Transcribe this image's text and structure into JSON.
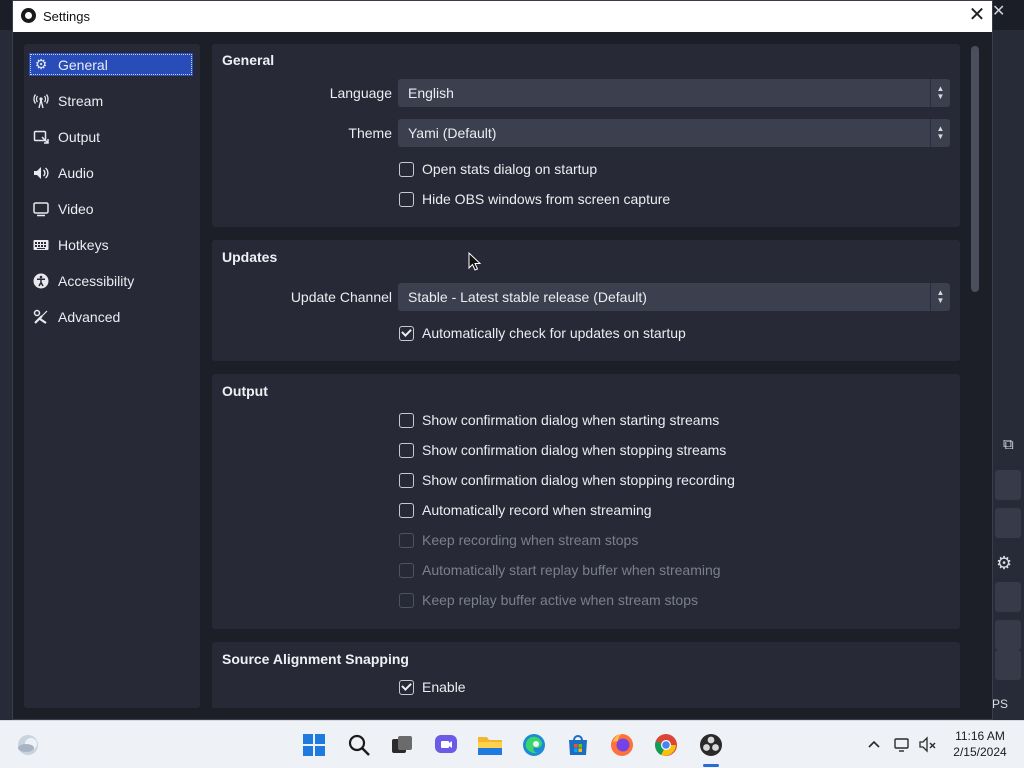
{
  "window": {
    "title": "Settings"
  },
  "sidebar": {
    "items": [
      {
        "label": "General",
        "icon": "gear-icon",
        "active": true
      },
      {
        "label": "Stream",
        "icon": "antenna-icon"
      },
      {
        "label": "Output",
        "icon": "output-icon"
      },
      {
        "label": "Audio",
        "icon": "speaker-icon"
      },
      {
        "label": "Video",
        "icon": "monitor-icon"
      },
      {
        "label": "Hotkeys",
        "icon": "keyboard-icon"
      },
      {
        "label": "Accessibility",
        "icon": "accessibility-icon"
      },
      {
        "label": "Advanced",
        "icon": "tools-icon"
      }
    ]
  },
  "general": {
    "title": "General",
    "language_label": "Language",
    "language_value": "English",
    "theme_label": "Theme",
    "theme_value": "Yami (Default)",
    "checks": [
      {
        "label": "Open stats dialog on startup",
        "checked": false
      },
      {
        "label": "Hide OBS windows from screen capture",
        "checked": false
      }
    ]
  },
  "updates": {
    "title": "Updates",
    "channel_label": "Update Channel",
    "channel_value": "Stable - Latest stable release (Default)",
    "checks": [
      {
        "label": "Automatically check for updates on startup",
        "checked": true
      }
    ]
  },
  "output": {
    "title": "Output",
    "checks": [
      {
        "label": "Show confirmation dialog when starting streams",
        "checked": false,
        "enabled": true
      },
      {
        "label": "Show confirmation dialog when stopping streams",
        "checked": false,
        "enabled": true
      },
      {
        "label": "Show confirmation dialog when stopping recording",
        "checked": false,
        "enabled": true
      },
      {
        "label": "Automatically record when streaming",
        "checked": false,
        "enabled": true
      },
      {
        "label": "Keep recording when stream stops",
        "checked": false,
        "enabled": false
      },
      {
        "label": "Automatically start replay buffer when streaming",
        "checked": false,
        "enabled": false
      },
      {
        "label": "Keep replay buffer active when stream stops",
        "checked": false,
        "enabled": false
      }
    ]
  },
  "snapping": {
    "title": "Source Alignment Snapping",
    "checks": [
      {
        "label": "Enable",
        "checked": true
      }
    ]
  },
  "taskbar": {
    "time": "11:16 AM",
    "date": "2/15/2024",
    "background_text": "PS"
  }
}
